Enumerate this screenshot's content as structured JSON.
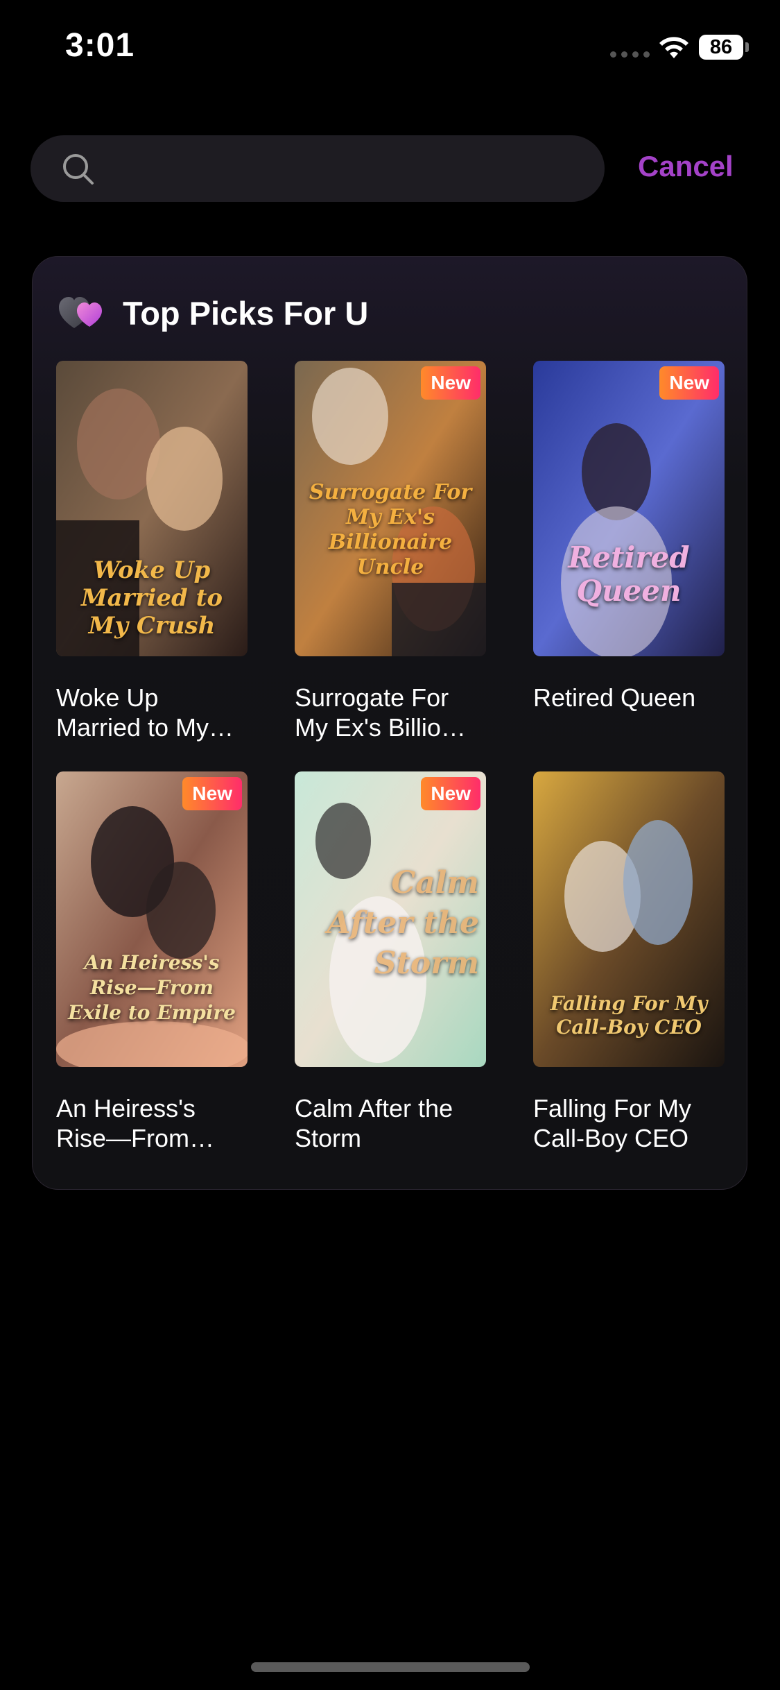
{
  "status": {
    "time": "3:01",
    "battery": "86"
  },
  "search": {
    "placeholder": "",
    "cancel_label": "Cancel"
  },
  "colors": {
    "accent": "#a442c8",
    "badge_start": "#ff8a2a",
    "badge_end": "#ff2d6a"
  },
  "top_picks": {
    "title": "Top Picks For U",
    "items": [
      {
        "title": "Woke Up Married to My…",
        "cover_text": "Woke Up Married to My Crush",
        "badge": ""
      },
      {
        "title": "Surrogate For My Ex's Billio…",
        "cover_text": "Surrogate For My Ex's Billionaire Uncle",
        "badge": "New"
      },
      {
        "title": "Retired Queen",
        "cover_text": "Retired Queen",
        "badge": "New"
      },
      {
        "title": "An Heiress's Rise—From Ex…",
        "cover_text": "An Heiress's Rise—From Exile to Empire",
        "badge": "New"
      },
      {
        "title": "Calm After the Storm",
        "cover_text": "Calm After the Storm",
        "badge": "New"
      },
      {
        "title": "Falling For My Call-Boy CEO",
        "cover_text": "Falling For My Call-Boy CEO",
        "badge": ""
      }
    ]
  }
}
